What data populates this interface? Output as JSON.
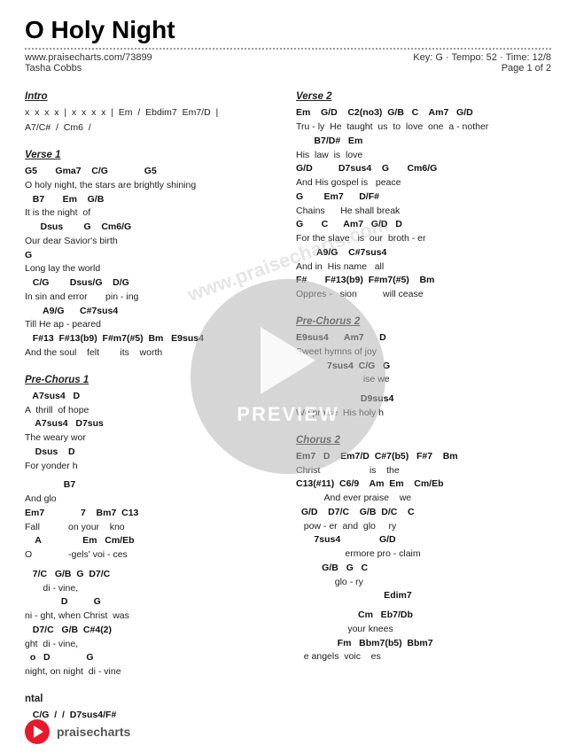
{
  "header": {
    "title": "O Holy Night",
    "url": "www.praisecharts.com/73899",
    "artist": "Tasha Cobbs",
    "key": "Key: G",
    "tempo": "Tempo: 52",
    "time": "Time: 12/8",
    "page": "Page 1 of 2"
  },
  "footer": {
    "brand": "praisecharts"
  },
  "preview": {
    "text": "PREVIEW"
  },
  "watermark": "www.praisecharts.com",
  "sections": {
    "left": [
      {
        "id": "intro",
        "label": "Intro",
        "lines": [
          {
            "type": "lyric",
            "text": "x  x  x  x  |  x  x  x  x  |  Em  /  Ebdim7  Em7/D  |"
          },
          {
            "type": "lyric",
            "text": "A7/C#  /  Cm6  /"
          }
        ]
      },
      {
        "id": "verse1",
        "label": "Verse 1",
        "lines": [
          {
            "type": "chord",
            "text": "G5       Gma7    C/G              G5"
          },
          {
            "type": "lyric",
            "text": "O holy night, the stars are brightly shining"
          },
          {
            "type": "chord",
            "text": "   B7       Em    G/B"
          },
          {
            "type": "lyric",
            "text": "It is the night  of"
          },
          {
            "type": "chord",
            "text": "      Dsus        G    Cm6/G"
          },
          {
            "type": "lyric",
            "text": "Our dear Savior's birth"
          },
          {
            "type": "chord",
            "text": "G"
          },
          {
            "type": "lyric",
            "text": "Long lay the world"
          },
          {
            "type": "chord",
            "text": "   C/G        Dsus/G    D/G"
          },
          {
            "type": "lyric",
            "text": "In sin and error       pin - ing"
          },
          {
            "type": "chord",
            "text": "       A9/G      C#7sus4"
          },
          {
            "type": "lyric",
            "text": "Till He ap - peared"
          },
          {
            "type": "chord",
            "text": "   F#13  F#13(b9)  F#m7(#5)  Bm   E9sus4"
          },
          {
            "type": "lyric",
            "text": "And the soul    felt        its    worth"
          }
        ]
      },
      {
        "id": "pre-chorus-1",
        "label": "Pre-Chorus 1",
        "lines": [
          {
            "type": "chord",
            "text": "   A7sus4   D"
          },
          {
            "type": "lyric",
            "text": "A  thrill  of hope"
          },
          {
            "type": "chord",
            "text": "    A7sus4   D7sus"
          },
          {
            "type": "lyric",
            "text": "The weary wor"
          },
          {
            "type": "chord",
            "text": "    Dsus    D"
          },
          {
            "type": "lyric",
            "text": "For yonder h"
          },
          {
            "type": "blank"
          },
          {
            "type": "chord",
            "text": "               B7"
          },
          {
            "type": "lyric",
            "text": "And glo"
          },
          {
            "type": "chord",
            "text": "Em7              7    Bm7  C13"
          },
          {
            "type": "lyric",
            "text": "Fall           on your    kno"
          },
          {
            "type": "chord",
            "text": "    A                Em   Cm/Eb"
          },
          {
            "type": "lyric",
            "text": "O              -gels' voi - ces"
          },
          {
            "type": "blank"
          },
          {
            "type": "chord",
            "text": "   7/C   G/B  G  D7/C"
          },
          {
            "type": "lyric",
            "text": "       di - vine,"
          },
          {
            "type": "chord",
            "text": "              D          G"
          },
          {
            "type": "lyric",
            "text": "ni - ght, when Christ  was"
          },
          {
            "type": "chord",
            "text": "   D7/C   G/B  C#4(2)"
          },
          {
            "type": "lyric",
            "text": "ght  di - vine,"
          },
          {
            "type": "chord",
            "text": "  o   D              G"
          },
          {
            "type": "lyric",
            "text": "night, on night  di - vine"
          },
          {
            "type": "blank"
          },
          {
            "type": "label-sub",
            "text": "ntal"
          },
          {
            "type": "chord",
            "text": "   C/G  /  /  D7sus4/F#"
          }
        ]
      }
    ],
    "right": [
      {
        "id": "verse2",
        "label": "Verse 2",
        "lines": [
          {
            "type": "chord",
            "text": "Em    G/D    C2(no3)  G/B   C    Am7   G/D"
          },
          {
            "type": "lyric",
            "text": "Tru - ly  He  taught  us  to  love  one  a - nother"
          },
          {
            "type": "chord",
            "text": "       B7/D#   Em"
          },
          {
            "type": "lyric",
            "text": "His  law  is  love"
          },
          {
            "type": "chord",
            "text": "G/D          D7sus4    G       Cm6/G"
          },
          {
            "type": "lyric",
            "text": "And His gospel is   peace"
          },
          {
            "type": "chord",
            "text": "G        Em7      D/F#"
          },
          {
            "type": "lyric",
            "text": "Chains      He shall break"
          },
          {
            "type": "chord",
            "text": "G       C      Am7   G/D   D"
          },
          {
            "type": "lyric",
            "text": "For the slave   is  our  broth - er"
          },
          {
            "type": "chord",
            "text": "        A9/G    C#7sus4"
          },
          {
            "type": "lyric",
            "text": "And in  His name   all"
          },
          {
            "type": "chord",
            "text": "F#       F#13(b9)  F#m7(#5)    Bm"
          },
          {
            "type": "lyric",
            "text": "Oppres -   sion          will cease"
          }
        ]
      },
      {
        "id": "pre-chorus-2",
        "label": "Pre-Chorus 2",
        "lines": [
          {
            "type": "chord",
            "text": "E9sus4      Am7      D"
          },
          {
            "type": "lyric",
            "text": "Sweet hymns of joy"
          },
          {
            "type": "chord",
            "text": "            7sus4  C/G   G"
          },
          {
            "type": "lyric",
            "text": "                          ise we"
          },
          {
            "type": "blank"
          },
          {
            "type": "chord",
            "text": "                         D9sus4"
          },
          {
            "type": "lyric",
            "text": "We praise  His holy h"
          },
          {
            "type": "blank"
          }
        ]
      },
      {
        "id": "chorus2",
        "label": "Chorus 2",
        "lines": [
          {
            "type": "chord",
            "text": "Em7   D    Em7/D  C#7(b5)   F#7    Bm"
          },
          {
            "type": "lyric",
            "text": "Christ                   is    the"
          },
          {
            "type": "chord",
            "text": "C13(#11)  C6/9    Am  Em    Cm/Eb"
          },
          {
            "type": "lyric",
            "text": "           And ever praise    we"
          },
          {
            "type": "chord",
            "text": "  G/D    D7/C    G/B  D/C    C"
          },
          {
            "type": "lyric",
            "text": "   pow - er  and  glo     ry"
          },
          {
            "type": "chord",
            "text": "       7sus4               G/D"
          },
          {
            "type": "lyric",
            "text": "                   ermore pro - claim"
          },
          {
            "type": "chord",
            "text": "          G/B   G   C"
          },
          {
            "type": "lyric",
            "text": "               glo - ry"
          },
          {
            "type": "chord",
            "text": "                                  Edim7"
          },
          {
            "type": "lyric",
            "text": ""
          },
          {
            "type": "blank"
          },
          {
            "type": "chord",
            "text": "                        Cm   Eb7/Db"
          },
          {
            "type": "lyric",
            "text": "                    your knees"
          },
          {
            "type": "chord",
            "text": "                Fm   Bbm7(b5)  Bbm7"
          },
          {
            "type": "lyric",
            "text": "   e angels  voic    es"
          }
        ]
      }
    ]
  }
}
